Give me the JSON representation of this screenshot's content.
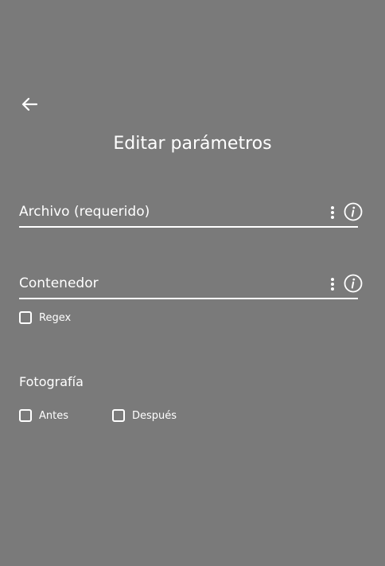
{
  "header": {
    "back_icon": "arrow-left-icon",
    "title": "Editar parámetros"
  },
  "fields": {
    "archivo": {
      "placeholder": "Archivo (requerido)",
      "value": "",
      "menu_icon": "kebab-menu-icon",
      "info_icon": "info-icon"
    },
    "contenedor": {
      "placeholder": "Contenedor",
      "value": "",
      "menu_icon": "kebab-menu-icon",
      "info_icon": "info-icon"
    }
  },
  "regex": {
    "label": "Regex",
    "checked": false
  },
  "fotografia": {
    "label": "Fotografía",
    "options": [
      {
        "label": "Antes",
        "checked": false
      },
      {
        "label": "Después",
        "checked": false
      }
    ]
  },
  "colors": {
    "background": "#7a7a7a",
    "foreground": "#ffffff"
  }
}
